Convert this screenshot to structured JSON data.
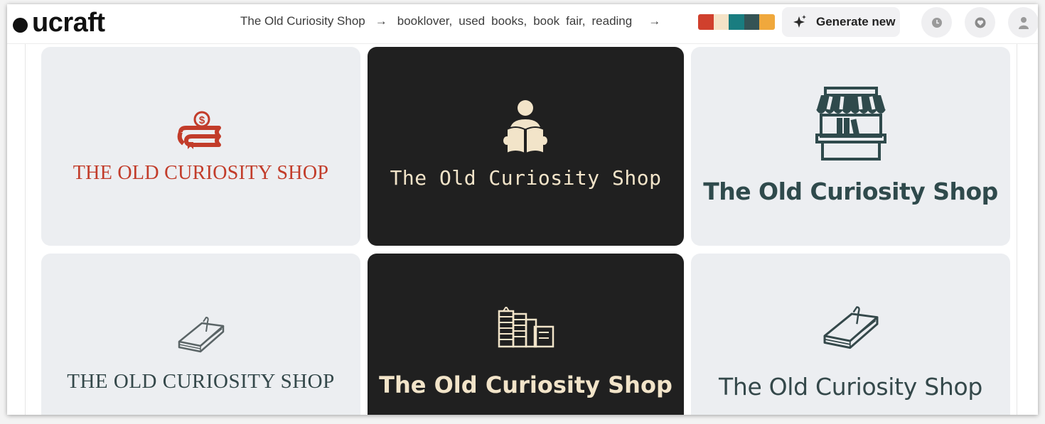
{
  "header": {
    "logo_text": "ucraft",
    "business_name": "The Old Curiosity Shop",
    "keywords": [
      "booklover,",
      "used",
      "books,",
      "book",
      "fair,",
      "reading"
    ],
    "palette": [
      "#d0402d",
      "#f5e3c7",
      "#197d80",
      "#345355",
      "#f0a83c"
    ],
    "generate_label": "Generate new",
    "icons": {
      "sparkle": "sparkle-icon",
      "history": "clock-icon",
      "favorites": "heart-icon",
      "account": "user-icon"
    }
  },
  "cards": [
    {
      "name": "THE OLD CURIOSITY SHOP",
      "theme": "light",
      "text_color": "#c23c2a",
      "icon": "book-coin-icon"
    },
    {
      "name": "The Old Curiosity Shop",
      "theme": "dark",
      "text_color": "#f2e4c9",
      "icon": "reader-icon"
    },
    {
      "name": "The Old Curiosity Shop",
      "theme": "light",
      "text_color": "#2f4a4c",
      "icon": "shop-stall-icon"
    },
    {
      "name": "THE OLD CURIOSITY SHOP",
      "theme": "light",
      "text_color": "#34484a",
      "icon": "book-bookmark-icon"
    },
    {
      "name": "The Old Curiosity Shop",
      "theme": "dark",
      "text_color": "#f2e4c9",
      "icon": "books-stack-icon"
    },
    {
      "name": "The Old Curiosity Shop",
      "theme": "light",
      "text_color": "#34484a",
      "icon": "book-bookmark-icon"
    }
  ]
}
